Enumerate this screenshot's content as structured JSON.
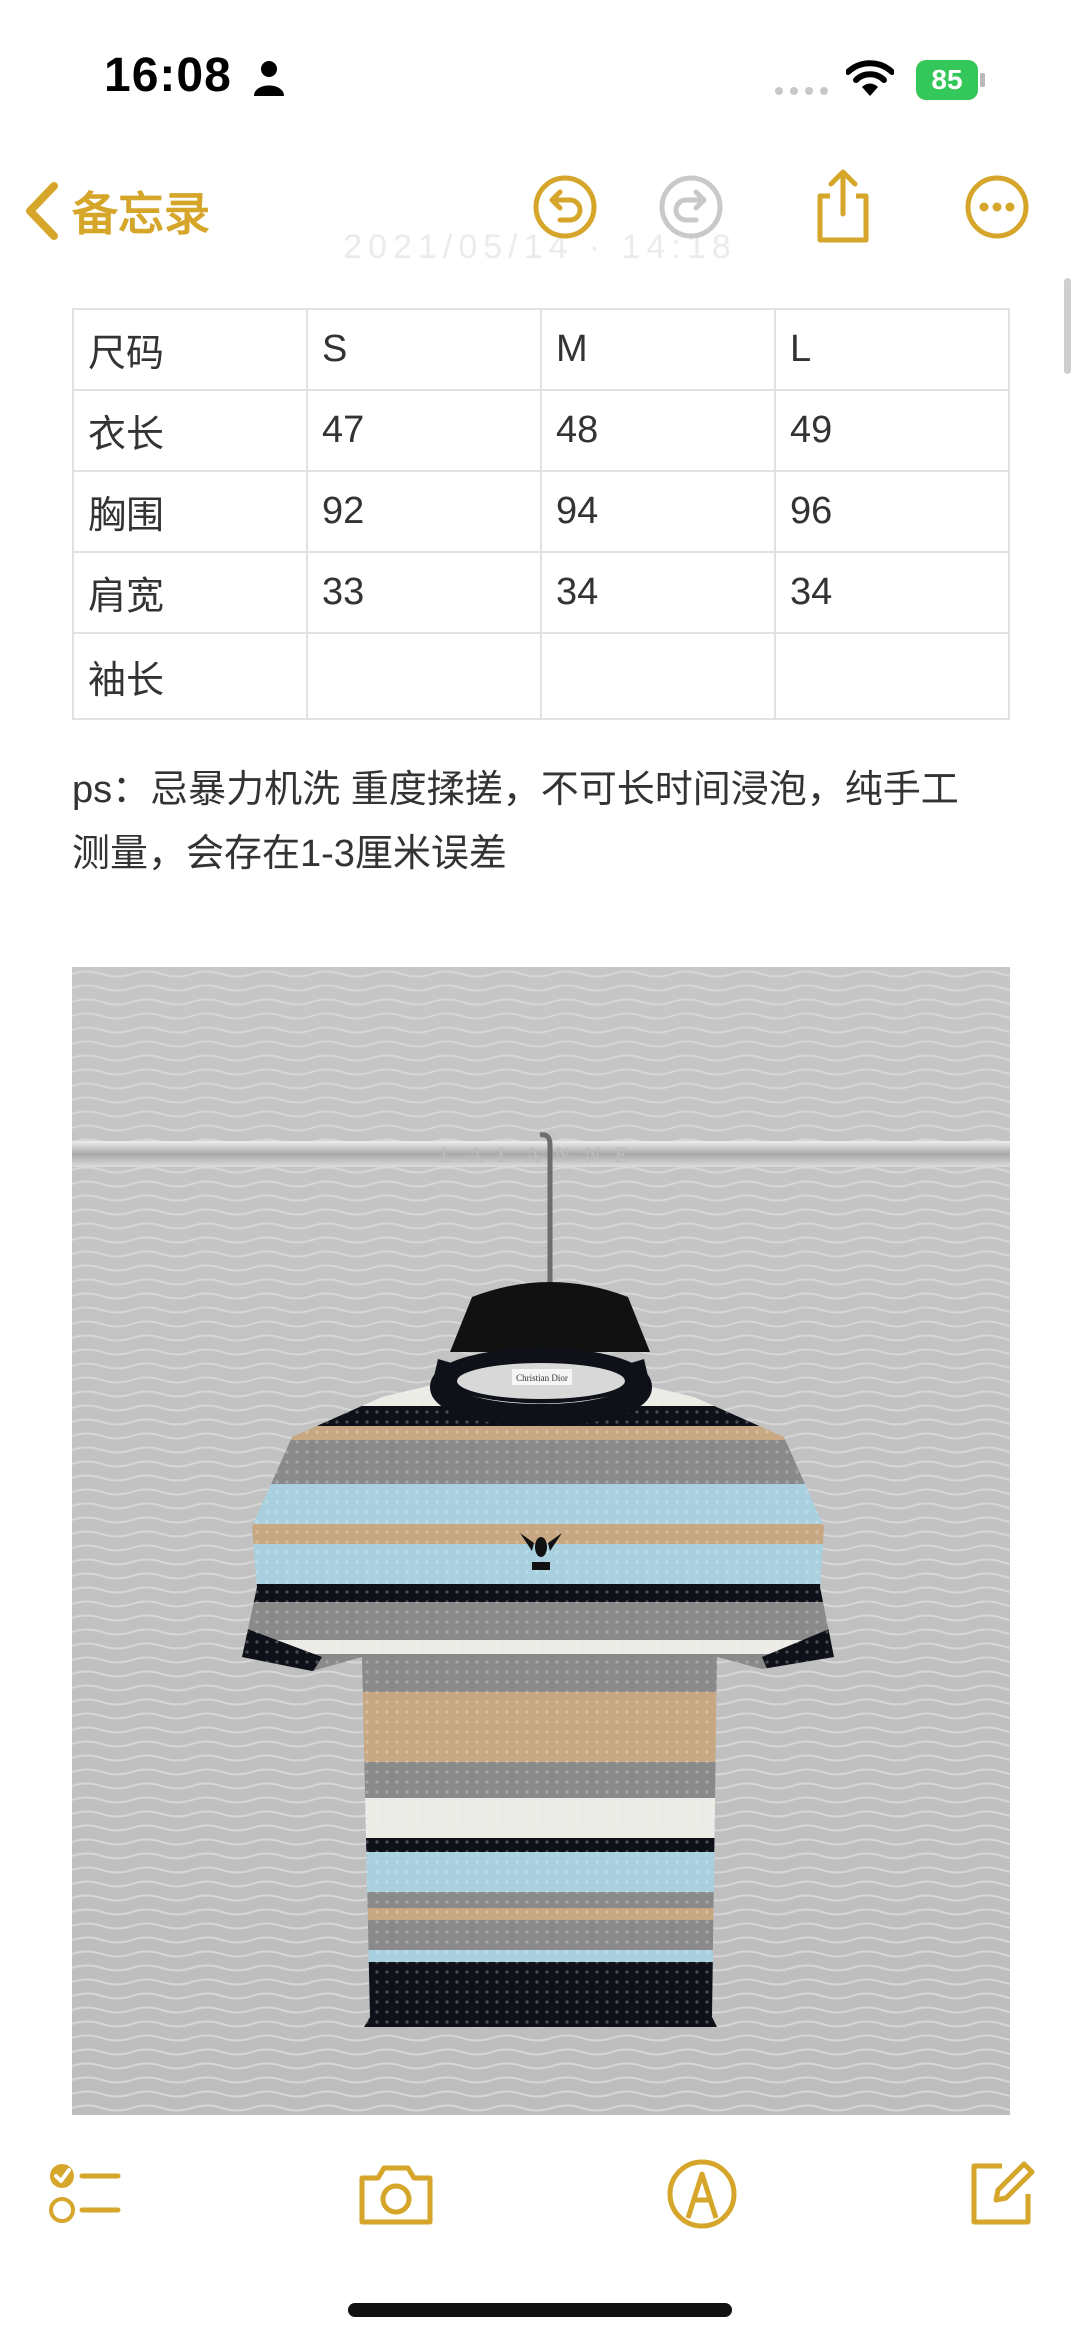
{
  "status": {
    "time": "16:08",
    "battery": "85"
  },
  "nav": {
    "back_label": "备忘录",
    "ghost_title": "2021/05/14 · 14:18"
  },
  "table": {
    "rows": [
      [
        "尺码",
        "S",
        "M",
        "L"
      ],
      [
        "衣长",
        "47",
        "48",
        "49"
      ],
      [
        "胸围",
        "92",
        "94",
        "96"
      ],
      [
        "肩宽",
        "33",
        "34",
        "34"
      ],
      [
        "袖长",
        "",
        "",
        ""
      ]
    ]
  },
  "note": {
    "ps_line1": "ps：忌暴力机洗 重度揉搓，不可长时间浸泡，纯手工",
    "ps_line2": "测量，会存在1-3厘米误差"
  },
  "photo": {
    "hanger_rail_text": "LALANNE",
    "label_text": "Christian Dior"
  },
  "icons": {
    "accent": "#d6a62b",
    "back": "chevron-left-icon",
    "undo": "undo-icon",
    "redo": "redo-icon",
    "share": "share-icon",
    "more": "more-icon",
    "checklist": "checklist-icon",
    "camera": "camera-icon",
    "markup": "markup-pen-icon",
    "compose": "compose-icon"
  }
}
